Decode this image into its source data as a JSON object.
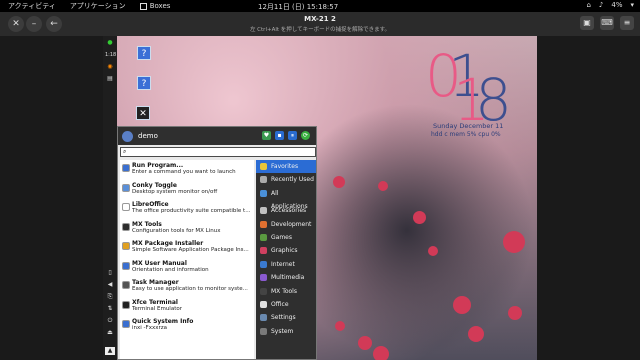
{
  "topbar": {
    "activities": "アクティビティ",
    "applications": "アプリケーション",
    "app_name": "Boxes",
    "datetime": "12月11日 (日) 15:18:57",
    "battery": "4%"
  },
  "window": {
    "title": "MX-21 2",
    "subtitle": "左 Ctrl+Alt を押してキーボードの捕捉を解除できます。"
  },
  "desktop": {
    "icon_labels": [
      "",
      "",
      ""
    ]
  },
  "panel": {
    "time": "1:18"
  },
  "clock": {
    "hours_pink": "0",
    "hours_blue": "1",
    "minutes_pink": "1",
    "minutes_blue": "8",
    "date": "Sunday  December 11",
    "stats": "hdd  c  mem  5%  cpu  0%"
  },
  "menu": {
    "user": "demo",
    "search_value": "",
    "apps": [
      {
        "title": "Run Program...",
        "desc": "Enter a command you want to launch",
        "color": "#3a6fd0"
      },
      {
        "title": "Conky Toggle",
        "desc": "Desktop system monitor on/off",
        "color": "#5a8fd8"
      },
      {
        "title": "LibreOffice",
        "desc": "The office productivity suite compatible t...",
        "color": "#ffffff"
      },
      {
        "title": "MX Tools",
        "desc": "Configuration tools for MX Linux",
        "color": "#2d2d2d"
      },
      {
        "title": "MX Package Installer",
        "desc": "Simple Software Application Package Ins...",
        "color": "#e0a020"
      },
      {
        "title": "MX User Manual",
        "desc": "Orientation and information",
        "color": "#3a6fd0"
      },
      {
        "title": "Task Manager",
        "desc": "Easy to use application to monitor syste...",
        "color": "#555555"
      },
      {
        "title": "Xfce Terminal",
        "desc": "Terminal Emulator",
        "color": "#222222"
      },
      {
        "title": "Quick System Info",
        "desc": "inxi -Fxxxrza",
        "color": "#3a6fd0"
      }
    ],
    "categories": [
      {
        "label": "Favorites",
        "color": "#e8c63a",
        "selected": true
      },
      {
        "label": "Recently Used",
        "color": "#aaaaaa",
        "selected": false
      },
      {
        "label": "All Applications",
        "color": "#4a90d9",
        "selected": false
      },
      {
        "label": "",
        "separator": true
      },
      {
        "label": "Accessories",
        "color": "#c0c0c0",
        "selected": false
      },
      {
        "label": "Development",
        "color": "#e07030",
        "selected": false
      },
      {
        "label": "Games",
        "color": "#5a9a40",
        "selected": false
      },
      {
        "label": "Graphics",
        "color": "#d04060",
        "selected": false
      },
      {
        "label": "Internet",
        "color": "#3a7ad0",
        "selected": false
      },
      {
        "label": "Multimedia",
        "color": "#8a5ad0",
        "selected": false
      },
      {
        "label": "MX Tools",
        "color": "#444444",
        "selected": false
      },
      {
        "label": "Office",
        "color": "#e0e0e0",
        "selected": false
      },
      {
        "label": "Settings",
        "color": "#6a8ab0",
        "selected": false
      },
      {
        "label": "System",
        "color": "#7a7a7a",
        "selected": false
      }
    ]
  }
}
